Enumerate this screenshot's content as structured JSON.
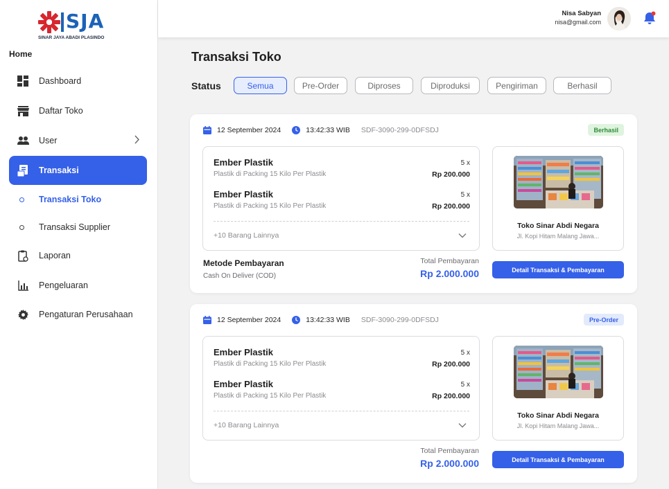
{
  "brand": {
    "name": "SJA",
    "subtitle": "SINAR JAYA ABADI PLASINDO"
  },
  "sidebar": {
    "section_label": "Home",
    "items": [
      {
        "label": "Dashboard",
        "icon": "dashboard-icon"
      },
      {
        "label": "Daftar Toko",
        "icon": "store-icon"
      },
      {
        "label": "User",
        "icon": "users-icon"
      },
      {
        "label": "Transaksi",
        "icon": "receipt-icon"
      },
      {
        "label": "Transaksi Toko"
      },
      {
        "label": "Transaksi Supplier"
      },
      {
        "label": "Laporan",
        "icon": "report-icon"
      },
      {
        "label": "Pengeluaran",
        "icon": "chart-icon"
      },
      {
        "label": "Pengaturan Perusahaan",
        "icon": "gear-icon"
      }
    ]
  },
  "header": {
    "user_name": "Nisa Sabyan",
    "user_email": "nisa@gmail.com"
  },
  "main": {
    "title": "Transaksi Toko",
    "status_label": "Status",
    "filters": [
      "Semua",
      "Pre-Order",
      "Diproses",
      "Diproduksi",
      "Pengiriman",
      "Berhasil"
    ],
    "active_filter": "Semua"
  },
  "transactions": [
    {
      "date": "12 September 2024",
      "time": "13:42:33 WIB",
      "code": "SDF-3090-299-0DFSDJ",
      "status": "Berhasil",
      "items": [
        {
          "name": "Ember Plastik",
          "desc": "Plastik di Packing 15 Kilo Per Plastik",
          "qty": "5 x",
          "price": "Rp 200.000"
        },
        {
          "name": "Ember Plastik",
          "desc": "Plastik di Packing 15 Kilo Per Plastik",
          "qty": "5 x",
          "price": "Rp 200.000"
        }
      ],
      "more": "+10 Barang Lainnya",
      "store_name": "Toko Sinar Abdi Negara",
      "store_address": "Jl. Kopi Hitam Malang Jawa...",
      "payment_label": "Metode Pembayaran",
      "payment_method": "Cash On Deliver (COD)",
      "total_label": "Total Pembayaran",
      "total": "Rp 2.000.000",
      "button": "Detail Transaksi & Pembayaran"
    },
    {
      "date": "12 September 2024",
      "time": "13:42:33 WIB",
      "code": "SDF-3090-299-0DFSDJ",
      "status": "Pre-Order",
      "items": [
        {
          "name": "Ember Plastik",
          "desc": "Plastik di Packing 15 Kilo Per Plastik",
          "qty": "5 x",
          "price": "Rp 200.000"
        },
        {
          "name": "Ember Plastik",
          "desc": "Plastik di Packing 15 Kilo Per Plastik",
          "qty": "5 x",
          "price": "Rp 200.000"
        }
      ],
      "more": "+10 Barang Lainnya",
      "store_name": "Toko Sinar Abdi Negara",
      "store_address": "Jl. Kopi Hitam Malang Jawa...",
      "total_label": "Total Pembayaran",
      "total": "Rp 2.000.000",
      "button": "Detail Transaksi & Pembayaran"
    }
  ],
  "colors": {
    "primary": "#3560e8",
    "success_bg": "#dff4de",
    "success_fg": "#2e8b3a",
    "brand_blue": "#1c63b7",
    "brand_red": "#d7262e"
  }
}
